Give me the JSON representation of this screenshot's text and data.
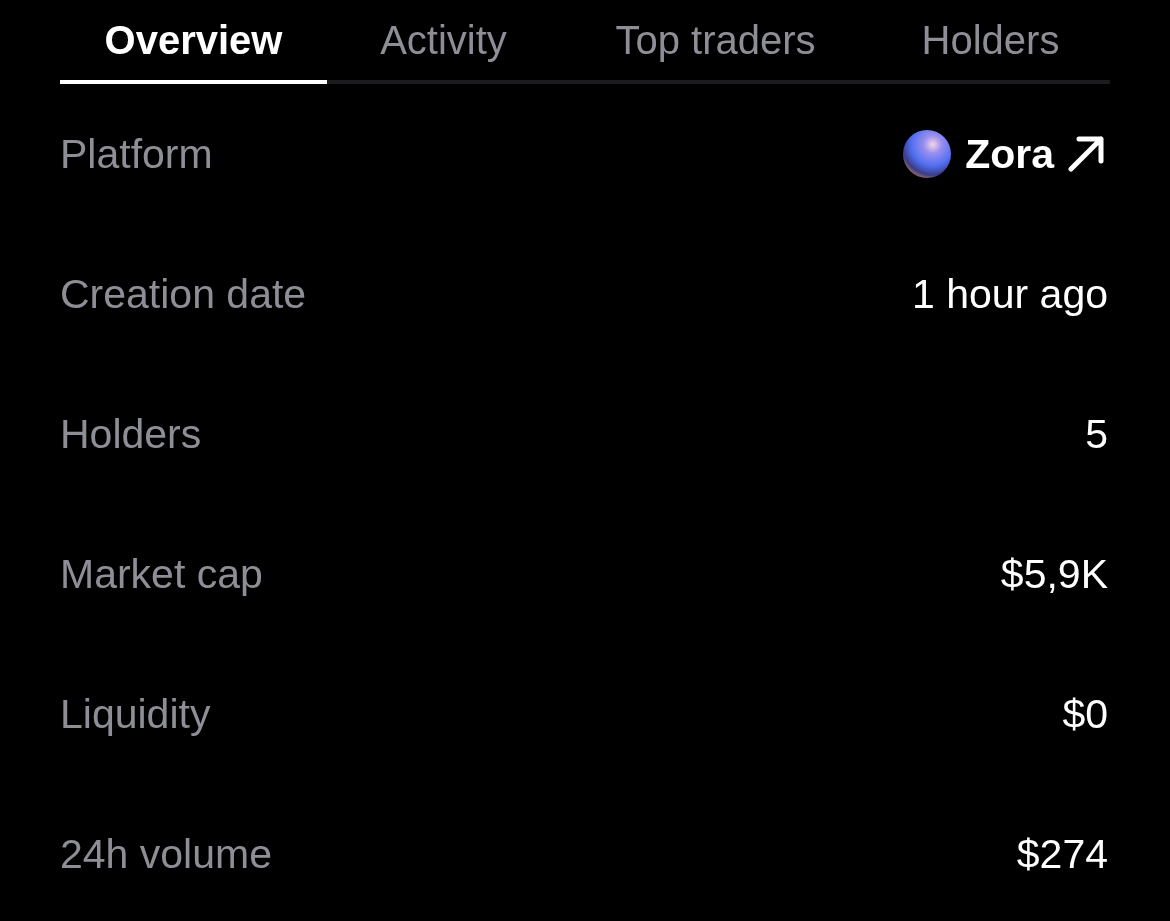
{
  "tabs": [
    {
      "label": "Overview",
      "selected": true
    },
    {
      "label": "Activity",
      "selected": false
    },
    {
      "label": "Top traders",
      "selected": false
    },
    {
      "label": "Holders",
      "selected": false
    }
  ],
  "rows": [
    {
      "kind": "link",
      "label": "Platform",
      "value": "Zora"
    },
    {
      "kind": "text",
      "label": "Creation date",
      "value": "1 hour ago"
    },
    {
      "kind": "text",
      "label": "Holders",
      "value": "5"
    },
    {
      "kind": "text",
      "label": "Market cap",
      "value": "$5,9K"
    },
    {
      "kind": "text",
      "label": "Liquidity",
      "value": "$0"
    },
    {
      "kind": "text",
      "label": "24h volume",
      "value": "$274"
    }
  ]
}
